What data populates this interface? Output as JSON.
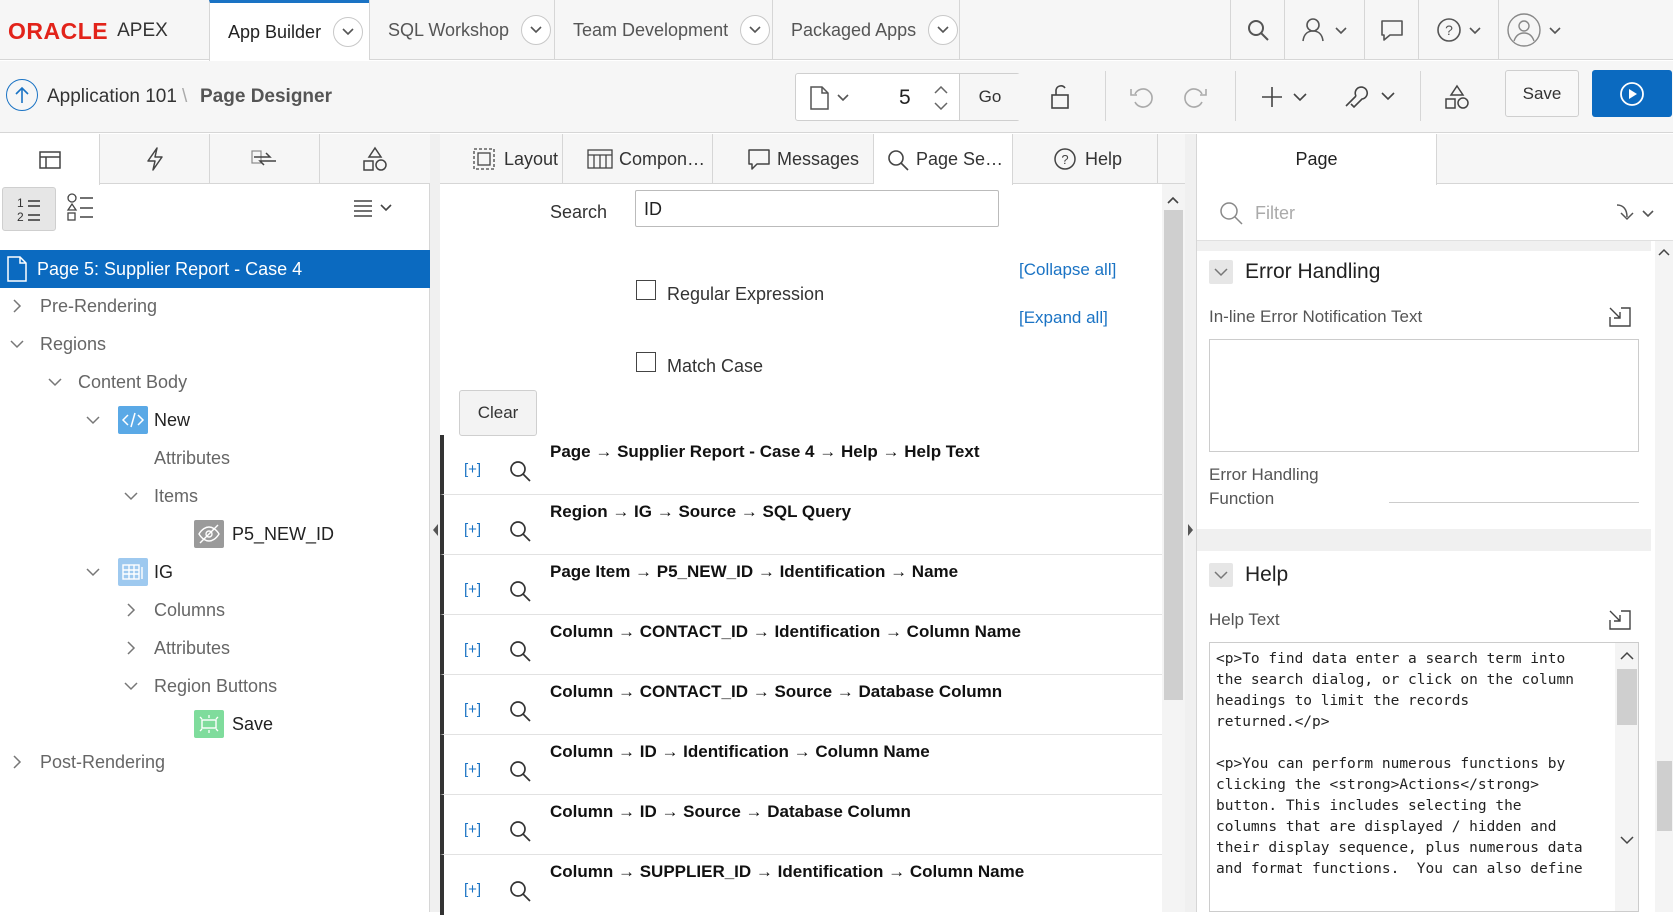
{
  "brand": {
    "oracle": "ORACLE",
    "apex": "APEX"
  },
  "nav_tabs": [
    "App Builder",
    "SQL Workshop",
    "Team Development",
    "Packaged Apps"
  ],
  "breadcrumb": {
    "app": "Application 101",
    "separator": "\\",
    "page": "Page Designer"
  },
  "toolbar": {
    "page_number": "5",
    "go_label": "Go",
    "save_label": "Save"
  },
  "tree": {
    "page": "Page 5: Supplier Report - Case 4",
    "items": [
      "Pre-Rendering",
      "Regions",
      "Content Body",
      "New",
      "Attributes",
      "Items",
      "P5_NEW_ID",
      "IG",
      "Columns",
      "Attributes",
      "Region Buttons",
      "Save",
      "Post-Rendering"
    ]
  },
  "mid_tabs": [
    "Layout",
    "Compon…",
    "Messages",
    "Page Se…",
    "Help"
  ],
  "search": {
    "label": "Search",
    "value": "ID",
    "collapse_all": "[Collapse all]",
    "expand_all": "[Expand all]",
    "regex_label": "Regular Expression",
    "match_case_label": "Match Case",
    "clear_label": "Clear"
  },
  "results": [
    "Page → Supplier Report - Case 4 → Help → Help Text",
    "Region → IG → Source → SQL Query",
    "Page Item → P5_NEW_ID → Identification → Name",
    "Column → CONTACT_ID → Identification → Column Name",
    "Column → CONTACT_ID → Source → Database Column",
    "Column → ID → Identification → Column Name",
    "Column → ID → Source → Database Column",
    "Column → SUPPLIER_ID → Identification → Column Name"
  ],
  "result_expand": "[+]",
  "right": {
    "tab": "Page",
    "filter_placeholder": "Filter",
    "error_handling": {
      "title": "Error Handling",
      "inline_label": "In-line Error Notification Text",
      "func_label_1": "Error Handling",
      "func_label_2": "Function"
    },
    "help": {
      "title": "Help",
      "text_label": "Help Text",
      "text": "<p>To find data enter a search term into\nthe search dialog, or click on the column\nheadings to limit the records\nreturned.</p>\n\n<p>You can perform numerous functions by\nclicking the <strong>Actions</strong>\nbutton. This includes selecting the\ncolumns that are displayed / hidden and\ntheir display sequence, plus numerous data\nand format functions.  You can also define"
    }
  },
  "colors": {
    "accent": "#0b6ac0",
    "oracle_red": "#e2231a",
    "link": "#1a73c4"
  }
}
